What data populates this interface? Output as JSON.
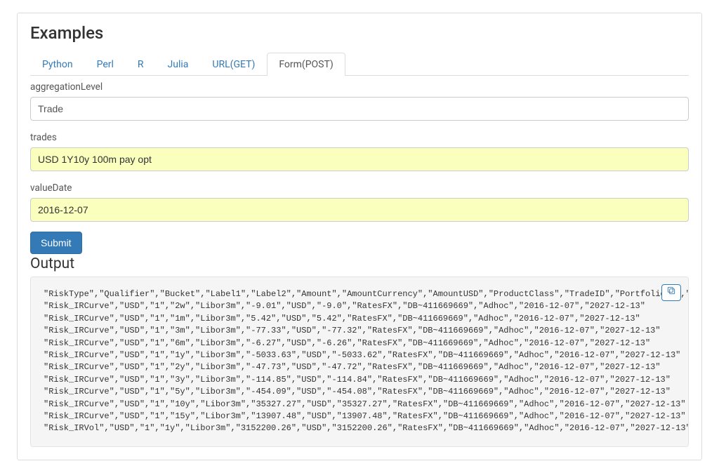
{
  "title": "Examples",
  "tabs": [
    {
      "label": "Python"
    },
    {
      "label": "Perl"
    },
    {
      "label": "R"
    },
    {
      "label": "Julia"
    },
    {
      "label": "URL(GET)"
    },
    {
      "label": "Form(POST)"
    }
  ],
  "form": {
    "aggregationLevel": {
      "label": "aggregationLevel",
      "value": "Trade"
    },
    "trades": {
      "label": "trades",
      "value": "USD 1Y10y 100m pay opt"
    },
    "valueDate": {
      "label": "valueDate",
      "value": "2016-12-07"
    },
    "submit": "Submit"
  },
  "output": {
    "label": "Output",
    "text": "\"RiskType\",\"Qualifier\",\"Bucket\",\"Label1\",\"Label2\",\"Amount\",\"AmountCurrency\",\"AmountUSD\",\"ProductClass\",\"TradeID\",\"PortfolioID\",\"ValuationDate\",\"EndDate\"\n\"Risk_IRCurve\",\"USD\",\"1\",\"2w\",\"Libor3m\",\"-9.01\",\"USD\",\"-9.0\",\"RatesFX\",\"DB~411669669\",\"Adhoc\",\"2016-12-07\",\"2027-12-13\"\n\"Risk_IRCurve\",\"USD\",\"1\",\"1m\",\"Libor3m\",\"5.42\",\"USD\",\"5.42\",\"RatesFX\",\"DB~411669669\",\"Adhoc\",\"2016-12-07\",\"2027-12-13\"\n\"Risk_IRCurve\",\"USD\",\"1\",\"3m\",\"Libor3m\",\"-77.33\",\"USD\",\"-77.32\",\"RatesFX\",\"DB~411669669\",\"Adhoc\",\"2016-12-07\",\"2027-12-13\"\n\"Risk_IRCurve\",\"USD\",\"1\",\"6m\",\"Libor3m\",\"-6.27\",\"USD\",\"-6.26\",\"RatesFX\",\"DB~411669669\",\"Adhoc\",\"2016-12-07\",\"2027-12-13\"\n\"Risk_IRCurve\",\"USD\",\"1\",\"1y\",\"Libor3m\",\"-5033.63\",\"USD\",\"-5033.62\",\"RatesFX\",\"DB~411669669\",\"Adhoc\",\"2016-12-07\",\"2027-12-13\"\n\"Risk_IRCurve\",\"USD\",\"1\",\"2y\",\"Libor3m\",\"-47.73\",\"USD\",\"-47.72\",\"RatesFX\",\"DB~411669669\",\"Adhoc\",\"2016-12-07\",\"2027-12-13\"\n\"Risk_IRCurve\",\"USD\",\"1\",\"3y\",\"Libor3m\",\"-114.85\",\"USD\",\"-114.84\",\"RatesFX\",\"DB~411669669\",\"Adhoc\",\"2016-12-07\",\"2027-12-13\"\n\"Risk_IRCurve\",\"USD\",\"1\",\"5y\",\"Libor3m\",\"-454.09\",\"USD\",\"-454.08\",\"RatesFX\",\"DB~411669669\",\"Adhoc\",\"2016-12-07\",\"2027-12-13\"\n\"Risk_IRCurve\",\"USD\",\"1\",\"10y\",\"Libor3m\",\"35327.27\",\"USD\",\"35327.27\",\"RatesFX\",\"DB~411669669\",\"Adhoc\",\"2016-12-07\",\"2027-12-13\"\n\"Risk_IRCurve\",\"USD\",\"1\",\"15y\",\"Libor3m\",\"13907.48\",\"USD\",\"13907.48\",\"RatesFX\",\"DB~411669669\",\"Adhoc\",\"2016-12-07\",\"2027-12-13\"\n\"Risk_IRVol\",\"USD\",\"1\",\"1y\",\"Libor3m\",\"3152200.26\",\"USD\",\"3152200.26\",\"RatesFX\",\"DB~411669669\",\"Adhoc\",\"2016-12-07\",\"2027-12-13\""
  }
}
